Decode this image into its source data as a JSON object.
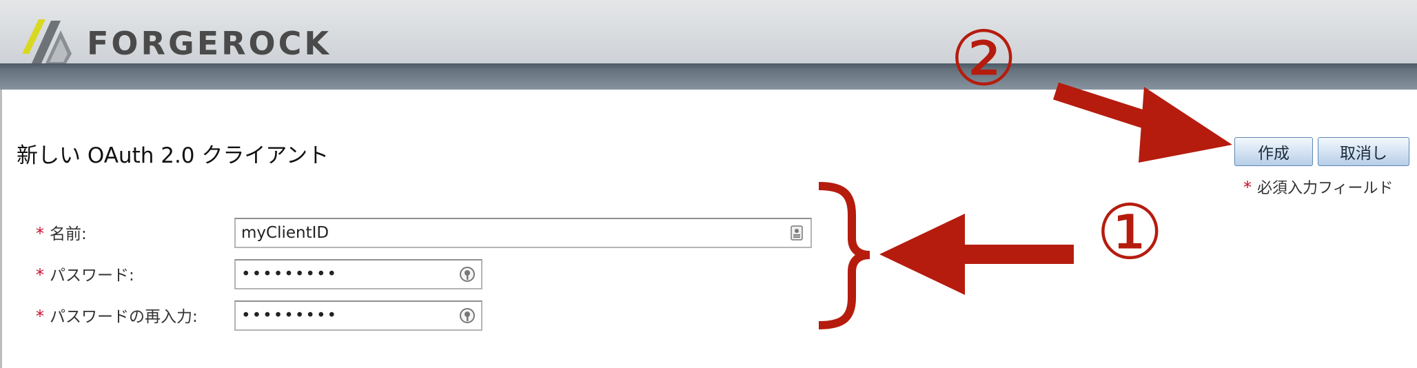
{
  "header": {
    "logo_text": "FORGEROCK",
    "logo_icon": "forgerock-logo-icon"
  },
  "page": {
    "title": "新しい OAuth 2.0 クライアント"
  },
  "actions": {
    "create_label": "作成",
    "cancel_label": "取消し"
  },
  "required_note": {
    "star": "*",
    "text": "必須入力フィールド"
  },
  "form": {
    "fields": [
      {
        "label": "名前:",
        "value": "myClientID",
        "icon": "contact-card-icon"
      },
      {
        "label": "パスワード:",
        "value": "•••••••••",
        "icon": "password-key-icon"
      },
      {
        "label": "パスワードの再入力:",
        "value": "•••••••••",
        "icon": "password-key-icon"
      }
    ]
  },
  "annotations": {
    "step1": "①",
    "step2": "②",
    "color": "#b51c0e"
  },
  "colors": {
    "button_border": "#5e87b6",
    "required_star": "#c8102e",
    "header_band": "#64717d"
  }
}
